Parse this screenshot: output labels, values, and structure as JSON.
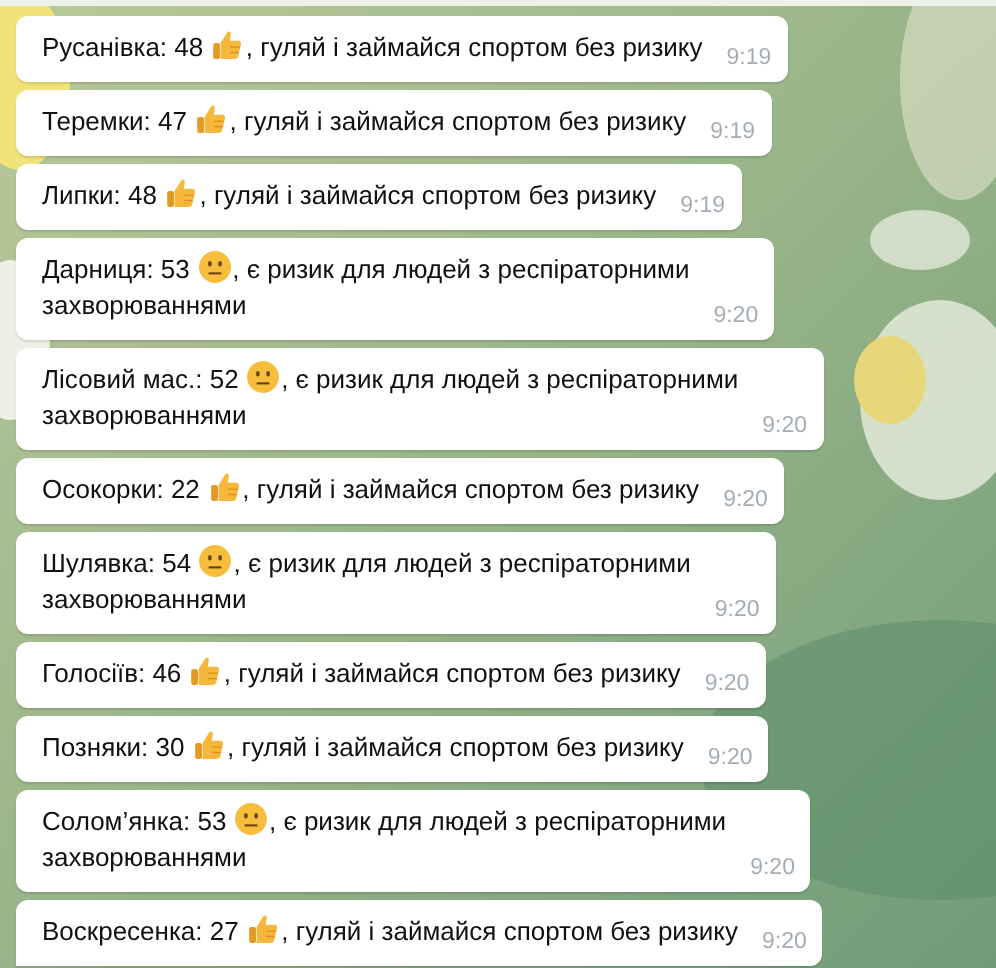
{
  "messages": [
    {
      "reading": "Русанівка: 48",
      "kind": "good",
      "advice": [
        ", гуляй і займайся спортом без ризику"
      ],
      "time": "9:19"
    },
    {
      "reading": "Теремки: 47",
      "kind": "good",
      "advice": [
        ", гуляй і займайся спортом без ризику"
      ],
      "time": "9:19"
    },
    {
      "reading": "Липки: 48",
      "kind": "good",
      "advice": [
        ", гуляй і займайся спортом без ризику"
      ],
      "time": "9:19"
    },
    {
      "reading": "Дарниця: 53",
      "kind": "risk",
      "advice": [
        ", є ризик для людей з респіраторними",
        "захворюваннями"
      ],
      "time": "9:20"
    },
    {
      "reading": "Лісовий мас.: 52",
      "kind": "risk",
      "advice": [
        ", є ризик для людей з респіраторними",
        "захворюваннями"
      ],
      "time": "9:20"
    },
    {
      "reading": "Осокорки: 22",
      "kind": "good",
      "advice": [
        ", гуляй і займайся спортом без ризику"
      ],
      "time": "9:20"
    },
    {
      "reading": "Шулявка: 54",
      "kind": "risk",
      "advice": [
        ", є ризик для людей з респіраторними",
        "захворюваннями"
      ],
      "time": "9:20"
    },
    {
      "reading": "Голосіїв: 46",
      "kind": "good",
      "advice": [
        ", гуляй і займайся спортом без ризику"
      ],
      "time": "9:20"
    },
    {
      "reading": "Позняки: 30",
      "kind": "good",
      "advice": [
        ", гуляй і займайся спортом без ризику"
      ],
      "time": "9:20"
    },
    {
      "reading": "Солом’янка: 53",
      "kind": "risk",
      "advice": [
        ", є ризик для людей з респіраторними",
        "захворюваннями"
      ],
      "time": "9:20"
    },
    {
      "reading": "Воскресенка: 27",
      "kind": "good",
      "advice": [
        ", гуляй і займайся спортом без ризику"
      ],
      "time": "9:20"
    }
  ]
}
